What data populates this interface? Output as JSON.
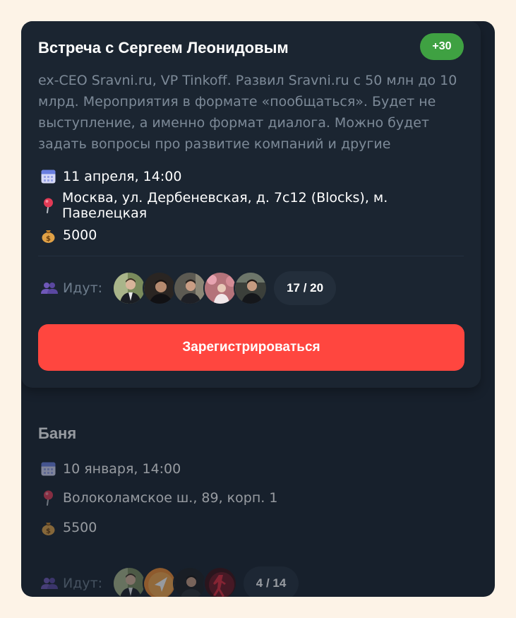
{
  "events": [
    {
      "title": "Встреча с Сергеем Леонидовым",
      "badge": "+30",
      "description": "ex-CEO Sravni.ru, VP Tinkoff. Развил Sravni.ru с 50 млн до 10 млрд. Мероприятия в формате «пообщаться». Будет не выступление, а именно формат диалога. Можно будет задать вопросы про развитие компаний и другие",
      "date": "11 апреля, 14:00",
      "location": "Москва, ул. Дербеневская, д. 7с12 (Blocks), м. Павелецкая",
      "price": "5000",
      "going_label": "Идут:",
      "attendees": "17 / 20",
      "register_label": "Зарегистрироваться"
    },
    {
      "title": "Баня",
      "date": "10 января, 14:00",
      "location": "Волоколамское ш., 89, корп. 1",
      "price": "5500",
      "going_label": "Идут:",
      "attendees": "4 / 14"
    }
  ],
  "icons": {
    "date": "calendar-icon",
    "location": "pin-icon",
    "price": "money-bag-icon",
    "going": "people-icon"
  },
  "colors": {
    "background": "#fdf3e7",
    "panel": "#17202c",
    "card": "#1b2531",
    "badge": "#3fa142",
    "register": "#ff463f"
  }
}
